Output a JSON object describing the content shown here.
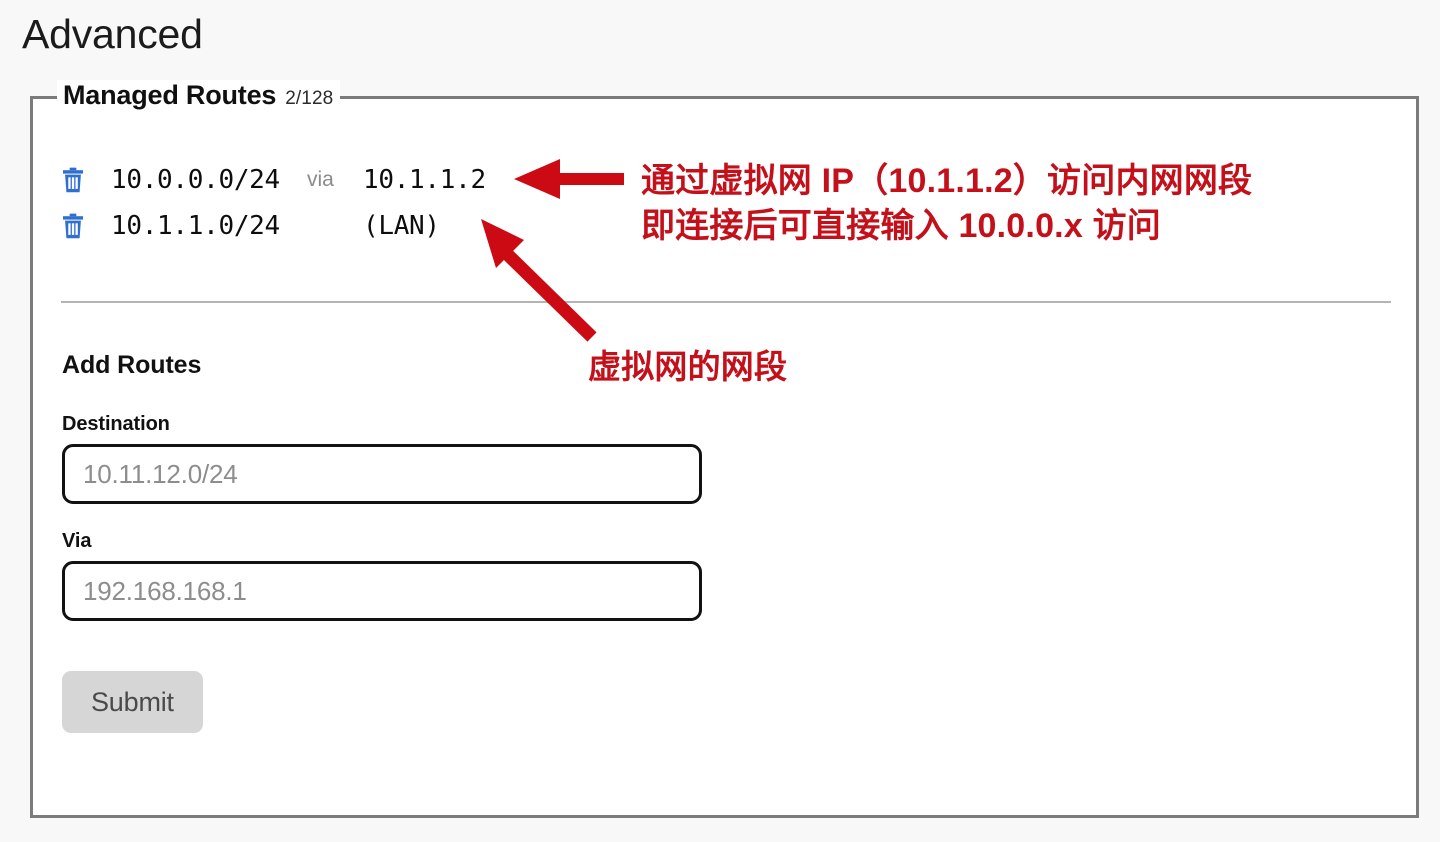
{
  "page": {
    "title": "Advanced",
    "background_color": "#f8f8f8",
    "panel_border_color": "#7b7b7b"
  },
  "managed_routes": {
    "legend_title": "Managed Routes",
    "count_label": "2/128",
    "rows": [
      {
        "delete_icon": "trash-icon",
        "destination": "10.0.0.0/24",
        "via_label": "via",
        "via_value": "10.1.1.2"
      },
      {
        "delete_icon": "trash-icon",
        "destination": "10.1.1.0/24",
        "via_label": "",
        "via_value": "(LAN)"
      }
    ],
    "trash_icon_color": "#2f6fd0"
  },
  "add_routes": {
    "heading": "Add Routes",
    "destination": {
      "label": "Destination",
      "value": "",
      "placeholder": "10.11.12.0/24"
    },
    "via": {
      "label": "Via",
      "value": "",
      "placeholder": "192.168.168.1"
    },
    "submit_label": "Submit",
    "submit_bg_color": "#d6d6d6"
  },
  "annotations": {
    "color": "#c4101a",
    "arrow_color": "#cc0a14",
    "note_1_line_1": "通过虚拟网 IP（10.1.1.2）访问内网网段",
    "note_1_line_2": "即连接后可直接输入 10.0.0.x 访问",
    "note_2": "虚拟网的网段"
  }
}
